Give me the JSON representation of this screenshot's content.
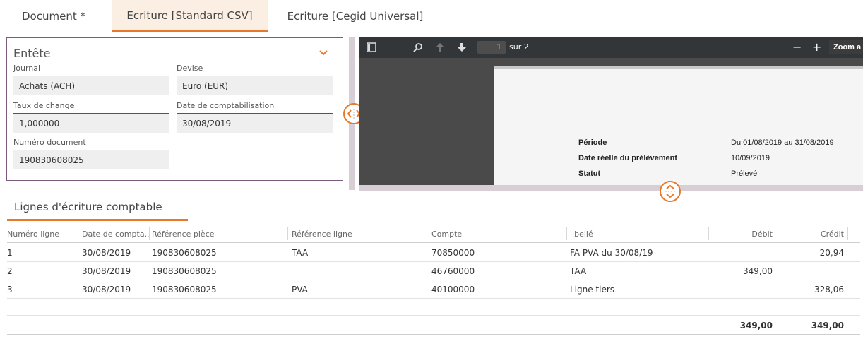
{
  "tabs": [
    {
      "label": "Document *",
      "active": false
    },
    {
      "label": "Ecriture [Standard CSV]",
      "active": true
    },
    {
      "label": "Ecriture [Cegid Universal]",
      "active": false
    }
  ],
  "header": {
    "title": "Entête",
    "fields": {
      "journal": {
        "label": "Journal",
        "value": "Achats (ACH)"
      },
      "devise": {
        "label": "Devise",
        "value": "Euro (EUR)"
      },
      "taux": {
        "label": "Taux de change",
        "value": "1,000000"
      },
      "date_compta": {
        "label": "Date de comptabilisation",
        "value": "30/08/2019"
      },
      "numero": {
        "label": "Numéro document",
        "value": "190830608025"
      }
    }
  },
  "pdf": {
    "page_current": "1",
    "page_total": "sur 2",
    "zoom_minus": "−",
    "zoom_plus": "+",
    "zoom_label": "Zoom a",
    "rows": [
      {
        "label": "Période",
        "value": "Du 01/08/2019 au 31/08/2019"
      },
      {
        "label": "Date réelle du prélèvement",
        "value": "10/09/2019"
      },
      {
        "label": "Statut",
        "value": "Prélevé"
      }
    ]
  },
  "lines": {
    "title": "Lignes d'écriture comptable",
    "columns": [
      "Numéro ligne",
      "Date de compta...",
      "Référence pièce",
      "Référence ligne",
      "Compte",
      "libellé",
      "Débit",
      "Crédit"
    ],
    "rows": [
      [
        "1",
        "30/08/2019",
        "190830608025",
        "TAA",
        "70850000",
        "FA PVA du 30/08/19",
        "",
        "20,94"
      ],
      [
        "2",
        "30/08/2019",
        "190830608025",
        "",
        "46760000",
        "TAA",
        "349,00",
        ""
      ],
      [
        "3",
        "30/08/2019",
        "190830608025",
        "PVA",
        "40100000",
        "Ligne tiers",
        "",
        "328,06"
      ]
    ],
    "totals": {
      "debit": "349,00",
      "credit": "349,00"
    }
  },
  "colors": {
    "accent": "#e8782a",
    "panel_border": "#7b5a7e",
    "active_tab_bg": "#fbeee3"
  }
}
